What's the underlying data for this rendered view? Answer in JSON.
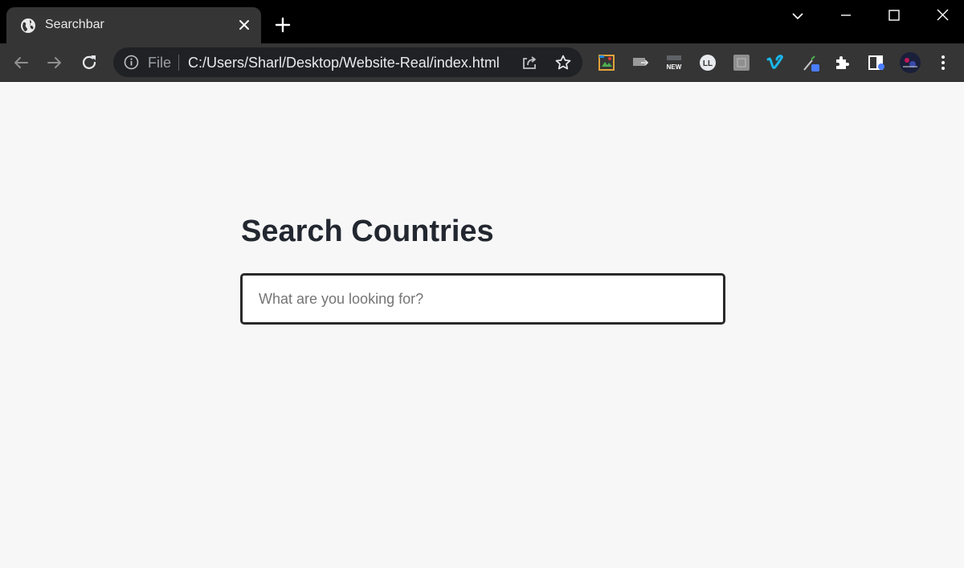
{
  "tab": {
    "title": "Searchbar",
    "favicon": "globe-icon"
  },
  "address_bar": {
    "scheme_label": "File",
    "url": "C:/Users/Sharl/Desktop/Website-Real/index.html"
  },
  "extensions": [
    "colorpick-extension-icon",
    "cast-extension-icon",
    "new-badge-extension-icon",
    "ll-extension-icon",
    "gray-square-extension-icon",
    "vimeo-extension-icon",
    "eyedropper-extension-icon",
    "puzzle-extensions-icon",
    "sidepanel-icon",
    "profile-avatar"
  ],
  "page": {
    "heading": "Search Countries",
    "search_placeholder": "What are you looking for?",
    "search_value": ""
  },
  "colors": {
    "tabstrip": "#000000",
    "toolbar": "#353535",
    "omnibox": "#202124",
    "page_bg": "#f7f7f7",
    "heading": "#222730",
    "input_border": "#2a2a2a"
  }
}
